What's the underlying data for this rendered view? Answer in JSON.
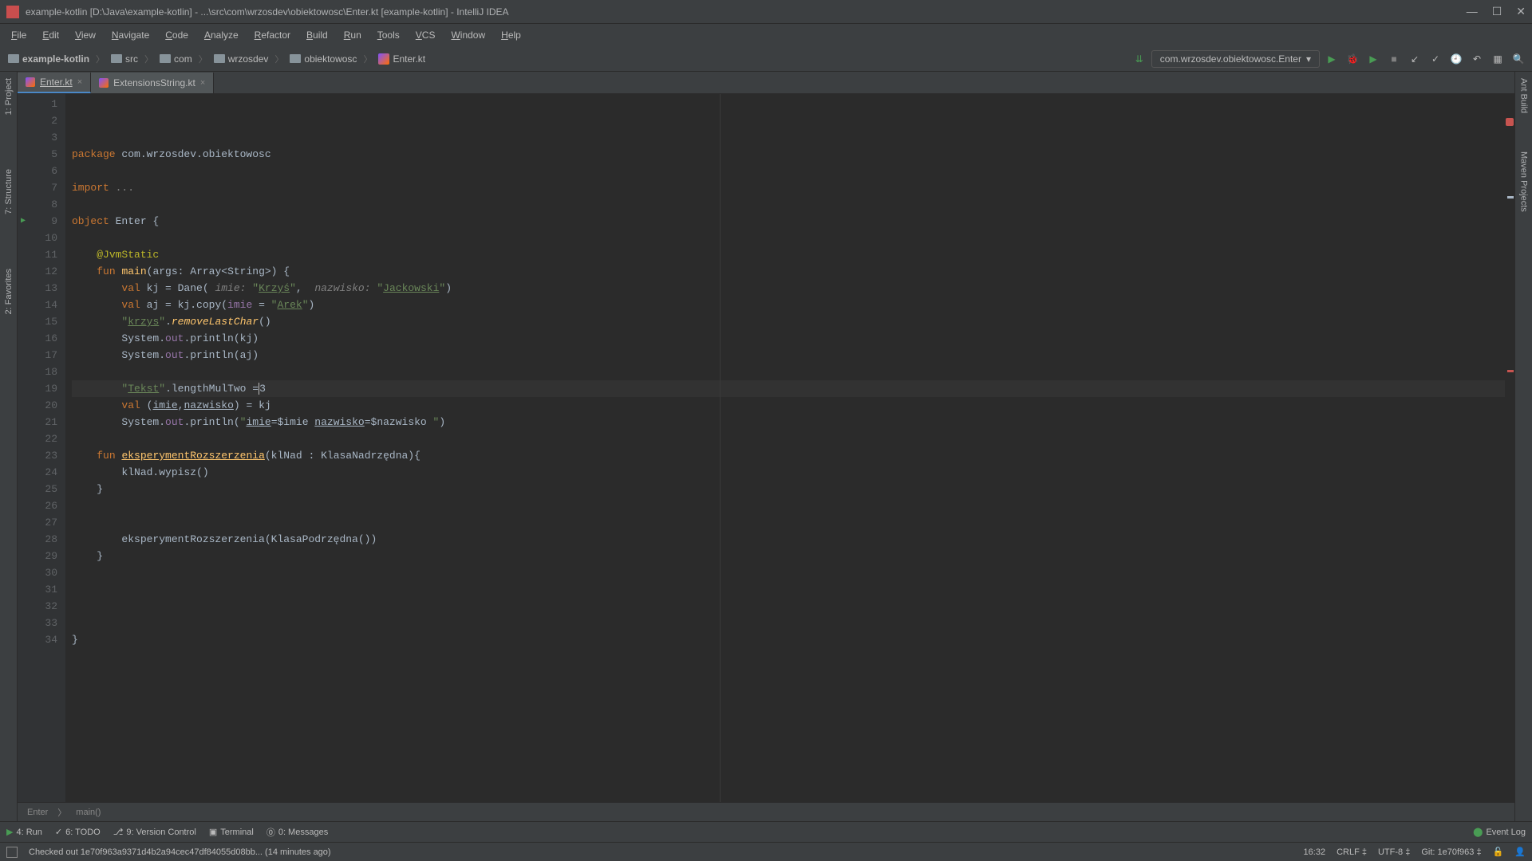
{
  "titlebar": {
    "text": "example-kotlin [D:\\Java\\example-kotlin] - ...\\src\\com\\wrzosdev\\obiektowosc\\Enter.kt [example-kotlin] - IntelliJ IDEA"
  },
  "menubar": [
    "File",
    "Edit",
    "View",
    "Navigate",
    "Code",
    "Analyze",
    "Refactor",
    "Build",
    "Run",
    "Tools",
    "VCS",
    "Window",
    "Help"
  ],
  "breadcrumbs": [
    {
      "icon": "folder",
      "label": "example-kotlin"
    },
    {
      "icon": "folder",
      "label": "src"
    },
    {
      "icon": "folder",
      "label": "com"
    },
    {
      "icon": "folder",
      "label": "wrzosdev"
    },
    {
      "icon": "folder",
      "label": "obiektowosc"
    },
    {
      "icon": "kt",
      "label": "Enter.kt"
    }
  ],
  "run_config": "com.wrzosdev.obiektowosc.Enter",
  "tabs": [
    {
      "label": "Enter.kt",
      "active": true
    },
    {
      "label": "ExtensionsString.kt",
      "active": false
    }
  ],
  "left_panels": [
    "1: Project",
    "7: Structure",
    "2: Favorites"
  ],
  "right_panels": [
    "Ant Build",
    "Maven Projects"
  ],
  "editor_breadcrumb": [
    "Enter",
    "main()"
  ],
  "bottom_tools": [
    {
      "icon": "▶",
      "label": "4: Run",
      "color": "#499c54"
    },
    {
      "icon": "✓",
      "label": "6: TODO",
      "color": "#bbb"
    },
    {
      "icon": "⎇",
      "label": "9: Version Control",
      "color": "#bbb"
    },
    {
      "icon": "▣",
      "label": "Terminal",
      "color": "#bbb"
    },
    {
      "icon": "⓪",
      "label": "0: Messages",
      "color": "#bbb"
    }
  ],
  "event_log": "Event Log",
  "status": {
    "message": "Checked out 1e70f963a9371d4b2a94cec47df84055d08bb... (14 minutes ago)",
    "pos": "16:32",
    "line_sep": "CRLF",
    "encoding": "UTF-8",
    "git": "Git: 1e70f963"
  },
  "code_lines": [
    {
      "n": 1,
      "html": "<span class='kw'>package</span> com.wrzosdev.obiektowosc"
    },
    {
      "n": 2,
      "html": ""
    },
    {
      "n": 3,
      "html": "<span class='kw'>import</span> <span class='comment'>...</span>"
    },
    {
      "n": 5,
      "html": ""
    },
    {
      "n": 6,
      "html": "<span class='kw'>object</span> Enter {"
    },
    {
      "n": 7,
      "html": ""
    },
    {
      "n": 8,
      "html": "    <span class='ann'>@JvmStatic</span>"
    },
    {
      "n": 9,
      "html": "    <span class='kw'>fun</span> <span class='fn'>main</span>(args: Array&lt;String&gt;) {",
      "run": true
    },
    {
      "n": 10,
      "html": "        <span class='kw'>val</span> kj = Dane( <span class='param'>imie:</span> <span class='str'>\"<span class='und'>Krzyś</span>\"</span>,  <span class='param'>nazwisko:</span> <span class='str'>\"<span class='und'>Jackowski</span>\"</span>)"
    },
    {
      "n": 11,
      "html": "        <span class='kw'>val</span> aj = kj.copy(<span class='field'>imie</span> = <span class='str'>\"<span class='und'>Arek</span>\"</span>)"
    },
    {
      "n": 12,
      "html": "        <span class='str'>\"<span class='und'>krzys</span>\"</span>.<span class='ext'>removeLastChar</span>()"
    },
    {
      "n": 13,
      "html": "        System.<span class='field'>out</span>.println(kj)"
    },
    {
      "n": 14,
      "html": "        System.<span class='field'>out</span>.println(aj)"
    },
    {
      "n": 15,
      "html": ""
    },
    {
      "n": 16,
      "html": "        <span class='str'>\"<span class='und'>Tekst</span>\"</span>.lengthMulTwo =<span class='caret'>3</span>",
      "hl": true
    },
    {
      "n": 17,
      "html": "        <span class='kw'>val</span> (<span class='und'>imie</span>,<span class='und'>nazwisko</span>) = kj"
    },
    {
      "n": 18,
      "html": "        System.<span class='field'>out</span>.println(<span class='str'>\"</span><span class='und'>imie</span>=$imie <span class='und'>nazwisko</span>=$nazwisko <span class='str'>\"</span>)"
    },
    {
      "n": 19,
      "html": ""
    },
    {
      "n": 20,
      "html": "    <span class='kw'>fun</span> <span class='fn und'>eksperymentRozszerzenia</span>(klNad : KlasaNadrzędna){"
    },
    {
      "n": 21,
      "html": "        klNad.wypisz()"
    },
    {
      "n": 22,
      "html": "    }"
    },
    {
      "n": 23,
      "html": ""
    },
    {
      "n": 24,
      "html": ""
    },
    {
      "n": 25,
      "html": "        eksperymentRozszerzenia(KlasaPodrzędna())"
    },
    {
      "n": 26,
      "html": "    }"
    },
    {
      "n": 27,
      "html": ""
    },
    {
      "n": 28,
      "html": ""
    },
    {
      "n": 29,
      "html": ""
    },
    {
      "n": 30,
      "html": ""
    },
    {
      "n": 31,
      "html": "}"
    },
    {
      "n": 32,
      "html": ""
    },
    {
      "n": 33,
      "html": ""
    },
    {
      "n": 34,
      "html": ""
    }
  ]
}
